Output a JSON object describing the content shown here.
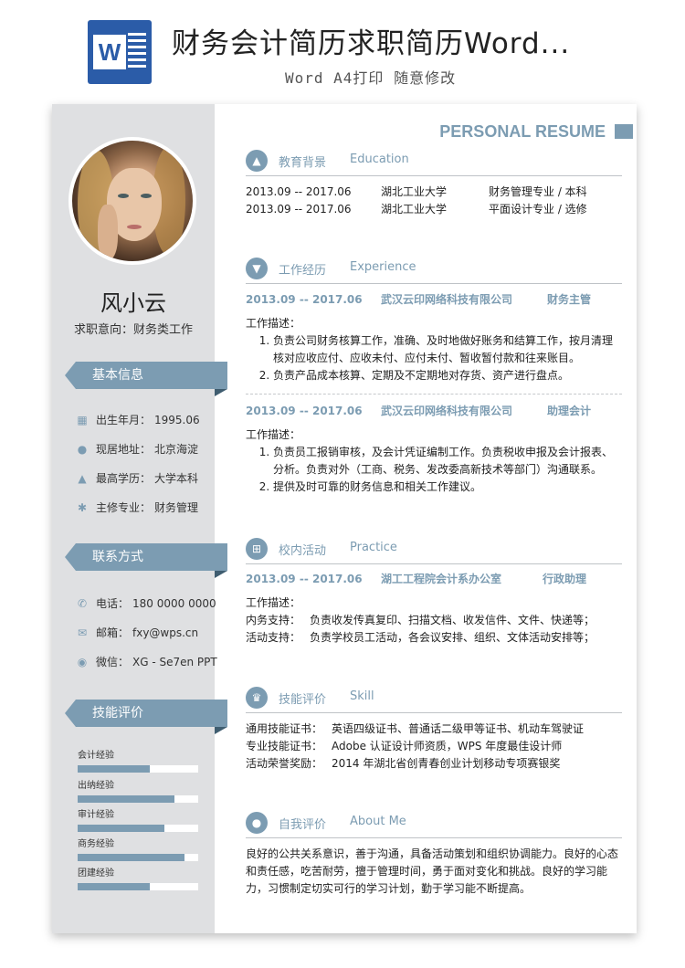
{
  "header": {
    "title": "财务会计简历求职简历Word...",
    "subtitle": "Word A4打印 随意修改",
    "logo_letter": "W"
  },
  "sidebar": {
    "name": "风小云",
    "objective": "求职意向：财务类工作",
    "basic_title": "基本信息",
    "basic": [
      {
        "icon": "calendar-icon",
        "label": "出生年月：",
        "value": "1995.06"
      },
      {
        "icon": "location-icon",
        "label": "现居地址：",
        "value": "北京海淀"
      },
      {
        "icon": "graduation-cap-icon",
        "label": "最高学历：",
        "value": "大学本科"
      },
      {
        "icon": "gear-icon",
        "label": "主修专业：",
        "value": "财务管理"
      }
    ],
    "contact_title": "联系方式",
    "contact": [
      {
        "icon": "phone-icon",
        "label": "电话：",
        "value": "180 0000 0000"
      },
      {
        "icon": "mail-icon",
        "label": "邮箱：",
        "value": "fxy@wps.cn"
      },
      {
        "icon": "wechat-icon",
        "label": "微信：",
        "value": "XG - Se7en PPT"
      }
    ],
    "skills_title": "技能评价",
    "skills": [
      {
        "label": "会计经验",
        "level": 0.6
      },
      {
        "label": "出纳经验",
        "level": 0.8
      },
      {
        "label": "审计经验",
        "level": 0.72
      },
      {
        "label": "商务经验",
        "level": 0.89
      },
      {
        "label": "团建经验",
        "level": 0.6
      }
    ]
  },
  "main": {
    "personal_resume": "PERSONAL RESUME",
    "education": {
      "title_cn": "教育背景",
      "title_en": "Education",
      "rows": [
        {
          "period": "2013.09 -- 2017.06",
          "school": "湖北工业大学",
          "major": "财务管理专业 / 本科"
        },
        {
          "period": "2013.09 -- 2017.06",
          "school": "湖北工业大学",
          "major": "平面设计专业 / 选修"
        }
      ]
    },
    "experience": {
      "title_cn": "工作经历",
      "title_en": "Experience",
      "jobs": [
        {
          "period": "2013.09 -- 2017.06",
          "company": "武汉云印网络科技有限公司",
          "role": "财务主管",
          "desc_label": "工作描述：",
          "items": [
            "负责公司财务核算工作，准确、及时地做好账务和结算工作，按月清理核对应收应付、应收未付、应付未付、暂收暂付款和往来账目。",
            "负责产品成本核算、定期及不定期地对存货、资产进行盘点。"
          ]
        },
        {
          "period": "2013.09 -- 2017.06",
          "company": "武汉云印网络科技有限公司",
          "role": "助理会计",
          "desc_label": "工作描述：",
          "items": [
            "负责员工报销审核，及会计凭证编制工作。负责税收申报及会计报表、分析。负责对外（工商、税务、发改委高新技术等部门）沟通联系。",
            "提供及时可靠的财务信息和相关工作建议。"
          ]
        }
      ]
    },
    "practice": {
      "title_cn": "校内活动",
      "title_en": "Practice",
      "period": "2013.09 -- 2017.06",
      "org": "湖工工程院会计系办公室",
      "role": "行政助理",
      "desc_label": "工作描述：",
      "items": [
        {
          "k": "内务支持：",
          "v": "负责收发传真复印、扫描文档、收发信件、文件、快递等；"
        },
        {
          "k": "活动支持：",
          "v": "负责学校员工活动，各会议安排、组织、文体活动安排等；"
        }
      ]
    },
    "skill": {
      "title_cn": "技能评价",
      "title_en": "Skill",
      "items": [
        {
          "k": "通用技能证书：",
          "v": "英语四级证书、普通话二级甲等证书、机动车驾驶证"
        },
        {
          "k": "专业技能证书：",
          "v": "Adobe 认证设计师资质，WPS 年度最佳设计师"
        },
        {
          "k": "活动荣誉奖励：",
          "v": "2014 年湖北省创青春创业计划移动专项赛银奖"
        }
      ]
    },
    "about": {
      "title_cn": "自我评价",
      "title_en": "About Me",
      "text": "良好的公共关系意识，善于沟通，具备活动策划和组织协调能力。良好的心态和责任感，吃苦耐劳，擅于管理时间，勇于面对变化和挑战。良好的学习能力，习惯制定切实可行的学习计划，勤于学习能不断提高。"
    }
  }
}
